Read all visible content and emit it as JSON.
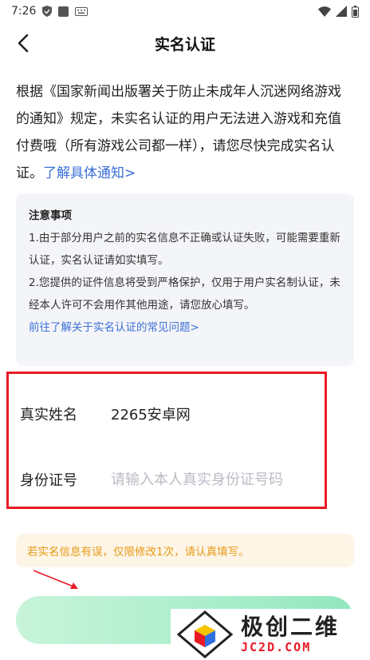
{
  "status_bar": {
    "time": "7:26",
    "icons": [
      "shield-icon",
      "app-icon",
      "keyboard-icon",
      "wifi-icon",
      "signal-icon",
      "battery-icon"
    ]
  },
  "nav": {
    "title": "实名认证",
    "back_icon": "chevron-left-icon"
  },
  "intro": {
    "text": "根据《国家新闻出版署关于防止未成年人沉迷网络游戏的通知》规定，未实名认证的用户无法进入游戏和充值付费哦（所有游戏公司都一样），请您尽快完成实名认证。",
    "link": "了解具体通知>"
  },
  "notice": {
    "title": "注意事项",
    "item1": "1.由于部分用户之前的实名信息不正确或认证失败，可能需要重新认证，实名认证请如实填写。",
    "item2": "2.您提供的证件信息将受到严格保护，仅用于用户实名制认证，未经本人许可不会用作其他用途，请您放心填写。",
    "link": "前往了解关于实名认证的常见问题>"
  },
  "form": {
    "name_label": "真实姓名",
    "name_value": "2265安卓网",
    "id_label": "身份证号",
    "id_placeholder": "请输入本人真实身份证号码",
    "id_value": ""
  },
  "warning": "若实名信息有误，仅限修改1次，请认真填写。",
  "watermark": {
    "cn": "极创二维",
    "en": "JC2D.COM"
  },
  "colors": {
    "link": "#3b6fd6",
    "highlight_border": "#e81a24",
    "warning_text": "#e89a17",
    "button_start": "#c8f4d9",
    "button_end": "#93e6bd"
  }
}
